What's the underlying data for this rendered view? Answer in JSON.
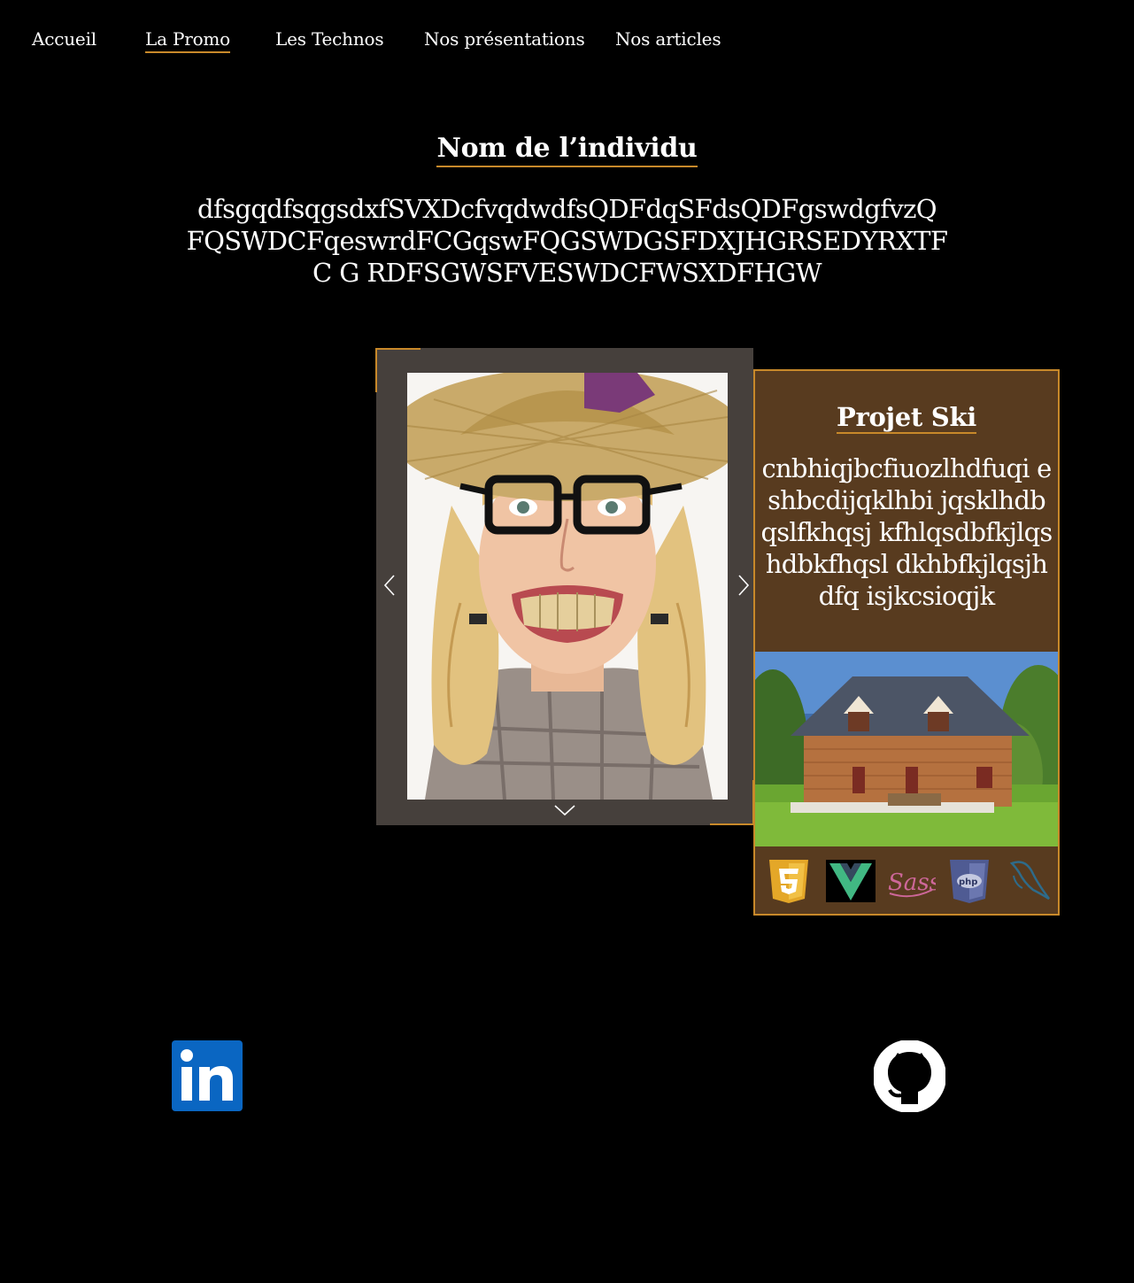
{
  "nav": {
    "items": [
      {
        "label": "Accueil"
      },
      {
        "label": "La Promo"
      },
      {
        "label": "Les Technos"
      },
      {
        "label": "Nos présentations"
      },
      {
        "label": "Nos articles"
      }
    ],
    "active_index": 1
  },
  "profile": {
    "name": "Nom de l’individu",
    "bio": "dfsgqdfsqgsdxfSVXDcfvqdwdfsQDFdqSFdsQDFgswdgfvzQ FQSWDCFqeswrdFCGqswFQGSWDGSFDXJHGRSEDYRXTFC G RDFSGWSFVESWDCFWSXDFHGW"
  },
  "carousel": {
    "prev_icon": "chevron-left-icon",
    "next_icon": "chevron-right-icon",
    "down_icon": "chevron-down-icon"
  },
  "project": {
    "title": "Projet Ski",
    "description": "cnbhiqjbcfiuozlhdfuqi eshbcdijqklhbi jqsklhdbqslfkhqsj kfhlqsdbfkjlqshdbkfhqsl dkhbfkjlqsjhdfq isjkcsioqjk",
    "technologies": [
      "html5-icon",
      "vuejs-icon",
      "sass-icon",
      "php-icon",
      "mysql-icon"
    ]
  },
  "footer": {
    "links": [
      "linkedin-icon",
      "github-icon"
    ]
  },
  "colors": {
    "accent": "#c8892a",
    "card_bg": "#583b1f",
    "carousel_bg": "#46403c",
    "background": "#000000"
  }
}
